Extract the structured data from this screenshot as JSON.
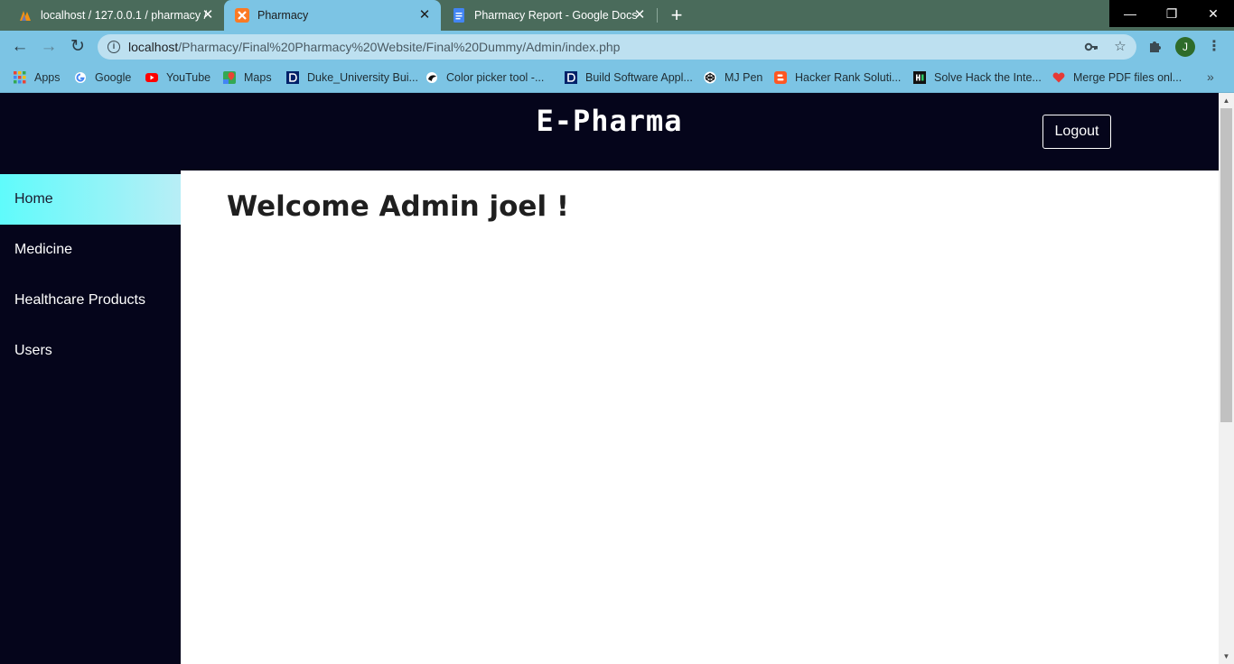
{
  "browser": {
    "tabs": [
      {
        "title": "localhost / 127.0.0.1 / pharmacy /",
        "favicon": "phpmyadmin-icon",
        "active": false
      },
      {
        "title": "Pharmacy",
        "favicon": "xampp-icon",
        "active": true
      },
      {
        "title": "Pharmacy Report - Google Docs",
        "favicon": "google-docs-icon",
        "active": false
      }
    ],
    "new_tab": "+",
    "window_controls": {
      "minimize": "—",
      "restore": "❐",
      "close": "✕"
    },
    "url_host": "localhost",
    "url_path": "/Pharmacy/Final%20Pharmacy%20Website/Final%20Dummy/Admin/index.php",
    "profile_initial": "J",
    "bookmarks": [
      {
        "label": "Apps",
        "icon": "apps-grid-icon"
      },
      {
        "label": "Google",
        "icon": "google-icon"
      },
      {
        "label": "YouTube",
        "icon": "youtube-icon"
      },
      {
        "label": "Maps",
        "icon": "maps-icon"
      },
      {
        "label": "Duke_University Bui...",
        "icon": "duke-icon"
      },
      {
        "label": "Color picker tool -...",
        "icon": "color-picker-icon"
      },
      {
        "label": "Build Software Appl...",
        "icon": "duke-icon"
      },
      {
        "label": "MJ Pen",
        "icon": "codepen-icon"
      },
      {
        "label": "Hacker Rank Soluti...",
        "icon": "blogger-icon"
      },
      {
        "label": "Solve Hack the Inte...",
        "icon": "hackerrank-icon"
      },
      {
        "label": "Merge PDF files onl...",
        "icon": "heart-icon"
      }
    ]
  },
  "page": {
    "brand": "E-Pharma",
    "logout_label": "Logout",
    "sidebar": [
      {
        "label": "Home",
        "active": true
      },
      {
        "label": "Medicine",
        "active": false
      },
      {
        "label": "Healthcare Products",
        "active": false
      },
      {
        "label": "Users",
        "active": false
      }
    ],
    "welcome": "Welcome Admin joel !"
  },
  "colors": {
    "header_bg": "#05051b",
    "active_item_gradient_start": "#5ffbfb",
    "active_item_gradient_end": "#b8eef6",
    "chrome_tab_active": "#7cc4e4",
    "chrome_frame": "#4a6b5b"
  }
}
